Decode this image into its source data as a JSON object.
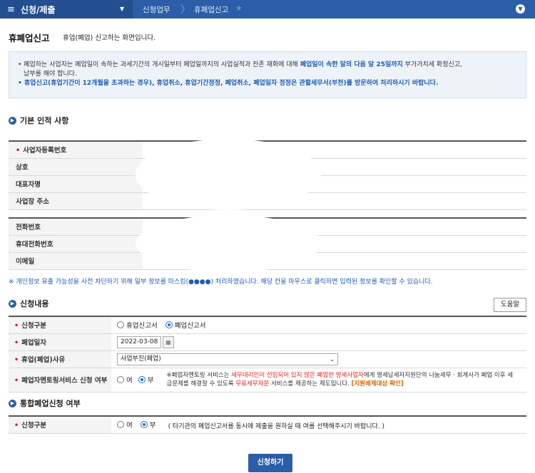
{
  "topbar": {
    "menu_label": "신청/제출",
    "crumb1": "신청업무",
    "crumb2": "휴폐업신고"
  },
  "page": {
    "title": "휴폐업신고",
    "subtitle": "휴업(폐업) 신고하는 화면입니다."
  },
  "notice": {
    "line1_a": "폐업하는 사업자는 폐업일이 속하는 과세기간의 개시일부터 폐업일까지의 사업실적과 잔존 재화에 대해 ",
    "line1_b": "폐업일이 속한 달의 다음 달 25일까지",
    "line1_c": " 부가가치세 확정신고,",
    "line1_d": "납부를 해야 합니다.",
    "line2": "휴업신고(휴업기간이 12개월을 초과하는 경우), 휴업취소, 휴업기간정정, 폐업취소, 폐업일자 정정은 관할세무서(부천)를 방문하여 처리하시기 바랍니다."
  },
  "basic_section": {
    "title": "기본 인적 사항",
    "rows1": [
      "사업자등록번호",
      "상호",
      "대표자명",
      "사업장 주소"
    ],
    "rows2": [
      "전화번호",
      "휴대전화번호",
      "이메일"
    ]
  },
  "mask_note": "※ 개인정보 유출 가능성을 사전 차단하기 위해 일부 정보를 마스킹(●●●●) 처리하였습니다. 해당 칸을 마우스로 클릭하면 입력된 정보를 확인할 수 있습니다.",
  "request_section": {
    "title": "신청내용",
    "help": "도움말",
    "type_label": "신청구분",
    "type_opt1": "휴업신고서",
    "type_opt2": "폐업신고서",
    "date_label": "폐업일자",
    "date_value": "2022-03-08",
    "reason_label": "휴업(폐업)사유",
    "reason_value": "사업부진(폐업)",
    "mentor_label": "폐업자멘토링서비스 신청 여부",
    "yes": "여",
    "no": "부",
    "mentor_note_a": "※폐업자멘토링 서비스는 ",
    "mentor_note_b": "세무대리인이 선임되어 있지 않은 폐업한 영세사업자",
    "mentor_note_c": "에게 영세납세자지원단의 나눔세무 · 회계사가 폐업 이후 세금문제를 해결할 수 있도록 ",
    "mentor_note_d": "무료세무자문",
    "mentor_note_e": " 서비스를 제공하는 제도입니다. ",
    "mentor_note_f": "[지원배제대상 확인]"
  },
  "merge_section": {
    "title": "통합폐업신청 여부",
    "label": "신청구분",
    "yes": "여",
    "no": "부",
    "note": "( 타기관의 폐업신고서를 동시에 제출을 원하실 때 여를 선택해주시기 바랍니다. )"
  },
  "submit_label": "신청하기"
}
